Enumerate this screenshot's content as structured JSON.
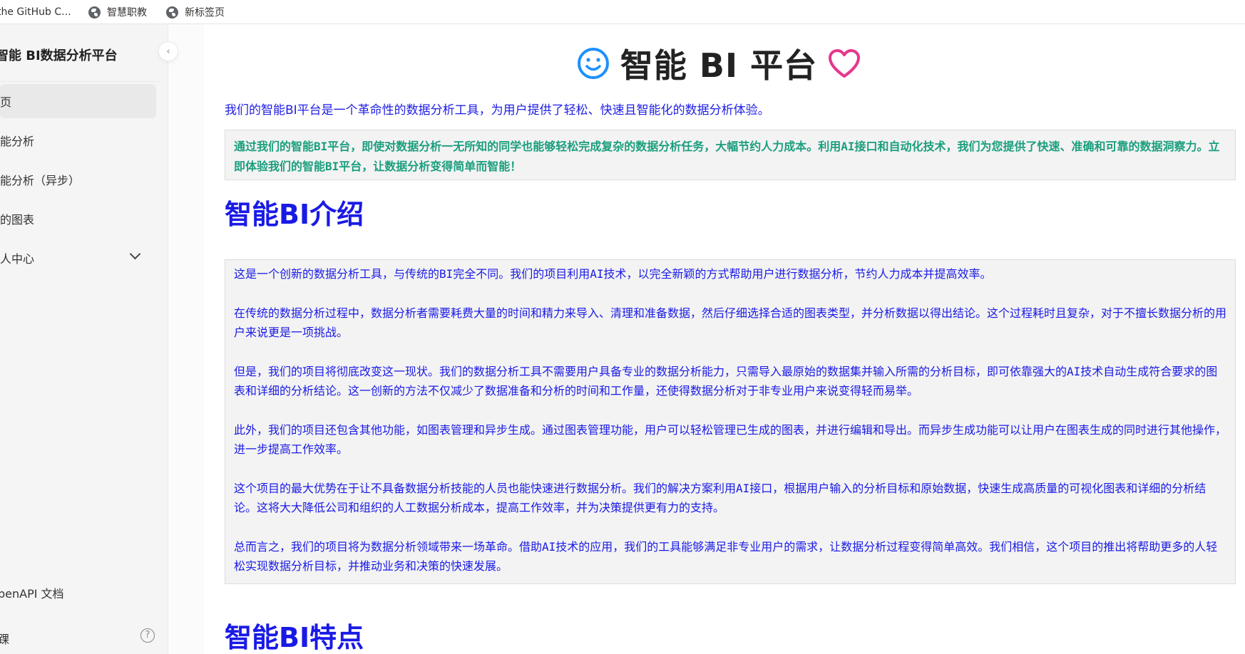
{
  "bookmarks": [
    {
      "label": "the GitHub C...",
      "icon": "globe-icon"
    },
    {
      "label": "智慧职教",
      "icon": "globe-icon"
    },
    {
      "label": "新标签页",
      "icon": "globe-icon"
    }
  ],
  "sidebar": {
    "title": "智能 BI数据分析平台",
    "items": [
      {
        "label": "页"
      },
      {
        "label": "能分析"
      },
      {
        "label": "能分析（异步）"
      },
      {
        "label": "的图表"
      },
      {
        "label": "人中心"
      }
    ],
    "bottom": [
      {
        "label": "penAPI 文档"
      },
      {
        "label": "踝"
      }
    ]
  },
  "main": {
    "hero_title": "智能 BI 平台",
    "intro": "我们的智能BI平台是一个革命性的数据分析工具，为用户提供了轻松、快速且智能化的数据分析体验。",
    "highlight": "通过我们的智能BI平台，即使对数据分析一无所知的同学也能够轻松完成复杂的数据分析任务，大幅节约人力成本。利用AI接口和自动化技术，我们为您提供了快速、准确和可靠的数据洞察力。立即体验我们的智能BI平台，让数据分析变得简单而智能！",
    "section1_title": "智能BI介绍",
    "section1_paragraphs": [
      "这是一个创新的数据分析工具，与传统的BI完全不同。我们的项目利用AI技术，以完全新颖的方式帮助用户进行数据分析，节约人力成本并提高效率。",
      "在传统的数据分析过程中，数据分析者需要耗费大量的时间和精力来导入、清理和准备数据，然后仔细选择合适的图表类型，并分析数据以得出结论。这个过程耗时且复杂，对于不擅长数据分析的用户来说更是一项挑战。",
      "但是，我们的项目将彻底改变这一现状。我们的数据分析工具不需要用户具备专业的数据分析能力，只需导入最原始的数据集并输入所需的分析目标，即可依靠强大的AI技术自动生成符合要求的图表和详细的分析结论。这一创新的方法不仅减少了数据准备和分析的时间和工作量，还使得数据分析对于非专业用户来说变得轻而易举。",
      "此外，我们的项目还包含其他功能，如图表管理和异步生成。通过图表管理功能，用户可以轻松管理已生成的图表，并进行编辑和导出。而异步生成功能可以让用户在图表生成的同时进行其他操作，进一步提高工作效率。",
      "这个项目的最大优势在于让不具备数据分析技能的人员也能快速进行数据分析。我们的解决方案利用AI接口，根据用户输入的分析目标和原始数据，快速生成高质量的可视化图表和详细的分析结论。这将大大降低公司和组织的人工数据分析成本，提高工作效率，并为决策提供更有力的支持。",
      "总而言之，我们的项目将为数据分析领域带来一场革命。借助AI技术的应用，我们的工具能够满足非专业用户的需求，让数据分析过程变得简单高效。我们相信，这个项目的推出将帮助更多的人轻松实现数据分析目标，并推动业务和决策的快速发展。"
    ],
    "section2_title": "智能BI特点"
  },
  "colors": {
    "accent_blue": "#1a1ae6",
    "green_text": "#1a9e7e",
    "icon_blue": "#1e90ff",
    "heart_pink": "#e8358c"
  }
}
